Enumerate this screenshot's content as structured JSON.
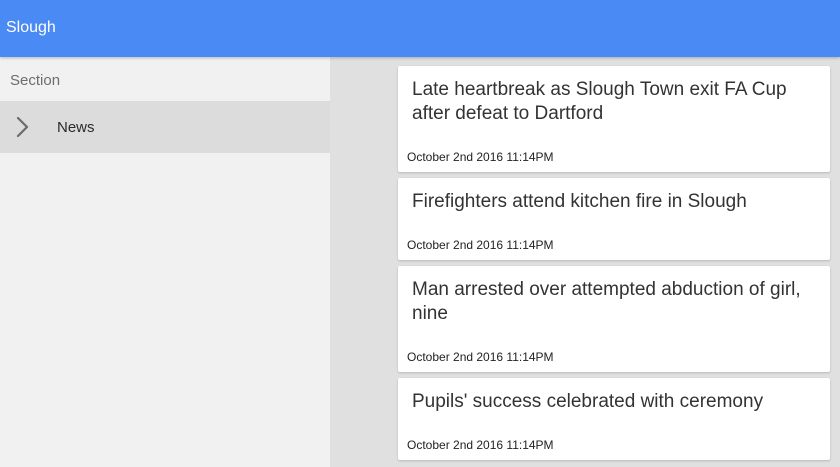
{
  "appbar": {
    "title": "Slough",
    "color": "#4a8af4"
  },
  "sidebar": {
    "section_label": "Section",
    "items": [
      {
        "label": "News",
        "icon": "chevron-right-icon",
        "selected": true
      }
    ]
  },
  "articles": [
    {
      "title": "Late heartbreak as Slough Town exit FA Cup after defeat to Dartford",
      "date": "October 2nd 2016 11:14PM"
    },
    {
      "title": "Firefighters attend kitchen fire in Slough",
      "date": "October 2nd 2016 11:14PM"
    },
    {
      "title": "Man arrested over attempted abduction of girl, nine",
      "date": "October 2nd 2016 11:14PM"
    },
    {
      "title": "Pupils' success celebrated with ceremony",
      "date": "October 2nd 2016 11:14PM"
    }
  ]
}
